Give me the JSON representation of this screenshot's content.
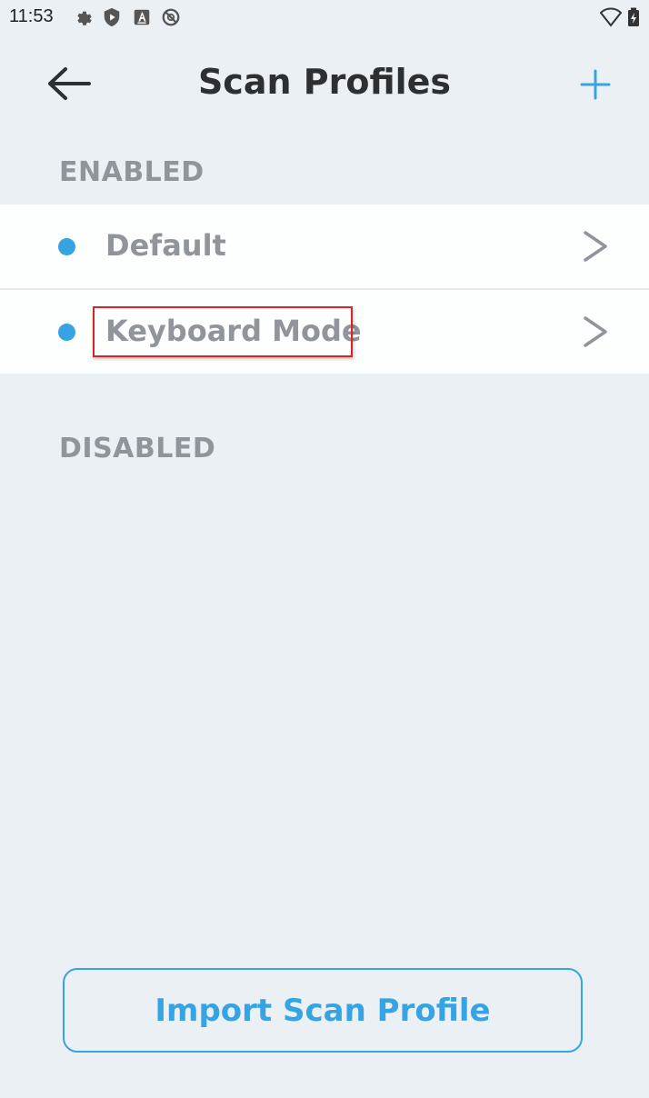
{
  "status_bar": {
    "time": "11:53"
  },
  "appbar": {
    "title": "Scan Profiles"
  },
  "sections": {
    "enabled_label": "ENABLED",
    "disabled_label": "DISABLED"
  },
  "profiles": [
    {
      "name": "Default",
      "status_color": "#36a3e3"
    },
    {
      "name": "Keyboard Mode",
      "status_color": "#36a3e3"
    }
  ],
  "import_button": {
    "label": "Import Scan Profile"
  },
  "colors": {
    "accent": "#36a3e3",
    "background": "#ebf0f5",
    "highlight": "#dd2222"
  }
}
